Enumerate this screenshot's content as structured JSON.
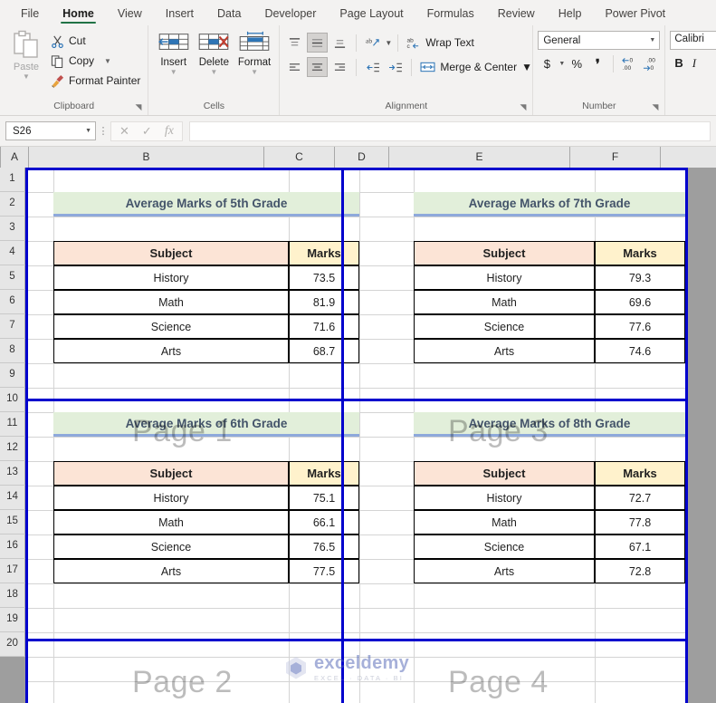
{
  "ribbon": {
    "tabs": [
      {
        "label": "File",
        "active": false
      },
      {
        "label": "Home",
        "active": true
      },
      {
        "label": "View",
        "active": false
      },
      {
        "label": "Insert",
        "active": false
      },
      {
        "label": "Data",
        "active": false
      },
      {
        "label": "Developer",
        "active": false
      },
      {
        "label": "Page Layout",
        "active": false
      },
      {
        "label": "Formulas",
        "active": false
      },
      {
        "label": "Review",
        "active": false
      },
      {
        "label": "Help",
        "active": false
      },
      {
        "label": "Power Pivot",
        "active": false
      }
    ],
    "clipboard": {
      "group_label": "Clipboard",
      "paste_label": "Paste",
      "cut_label": "Cut",
      "copy_label": "Copy",
      "format_painter_label": "Format Painter"
    },
    "cells": {
      "group_label": "Cells",
      "insert_label": "Insert",
      "delete_label": "Delete",
      "format_label": "Format"
    },
    "alignment": {
      "group_label": "Alignment",
      "wrap_text_label": "Wrap Text",
      "merge_center_label": "Merge & Center"
    },
    "number": {
      "group_label": "Number",
      "format_value": "General",
      "currency_symbol": "$",
      "percent_symbol": "%",
      "comma_symbol": "‚"
    },
    "font": {
      "font_name": "Calibri",
      "bold_label": "B",
      "italic_label": "I"
    }
  },
  "formula_bar": {
    "name_box_value": "S26",
    "formula_value": ""
  },
  "grid": {
    "columns": [
      "A",
      "B",
      "C",
      "D",
      "E",
      "F"
    ],
    "rows": [
      "1",
      "2",
      "3",
      "4",
      "5",
      "6",
      "7",
      "8",
      "9",
      "10",
      "11",
      "12",
      "13",
      "14",
      "15",
      "16",
      "17",
      "18",
      "19",
      "20"
    ],
    "page_labels": [
      "Page 1",
      "Page 2",
      "Page 3",
      "Page 4"
    ]
  },
  "tables": [
    {
      "title": "Average Marks of 5th Grade",
      "headers": [
        "Subject",
        "Marks"
      ],
      "rows": [
        [
          "History",
          "73.5"
        ],
        [
          "Math",
          "81.9"
        ],
        [
          "Science",
          "71.6"
        ],
        [
          "Arts",
          "68.7"
        ]
      ]
    },
    {
      "title": "Average Marks of 7th Grade",
      "headers": [
        "Subject",
        "Marks"
      ],
      "rows": [
        [
          "History",
          "79.3"
        ],
        [
          "Math",
          "69.6"
        ],
        [
          "Science",
          "77.6"
        ],
        [
          "Arts",
          "74.6"
        ]
      ]
    },
    {
      "title": "Average Marks of 6th Grade",
      "headers": [
        "Subject",
        "Marks"
      ],
      "rows": [
        [
          "History",
          "75.1"
        ],
        [
          "Math",
          "66.1"
        ],
        [
          "Science",
          "76.5"
        ],
        [
          "Arts",
          "77.5"
        ]
      ]
    },
    {
      "title": "Average Marks of 8th Grade",
      "headers": [
        "Subject",
        "Marks"
      ],
      "rows": [
        [
          "History",
          "72.7"
        ],
        [
          "Math",
          "77.8"
        ],
        [
          "Science",
          "67.1"
        ],
        [
          "Arts",
          "72.8"
        ]
      ]
    }
  ],
  "watermark": {
    "main": "exceldemy",
    "sub": "EXCEL · DATA · BI"
  },
  "colors": {
    "accent_green": "#217346",
    "title_fill": "#e2efda",
    "title_text": "#44546a",
    "subject_fill": "#fce4d6",
    "marks_fill": "#fff2cc",
    "page_break": "#0000cd"
  }
}
